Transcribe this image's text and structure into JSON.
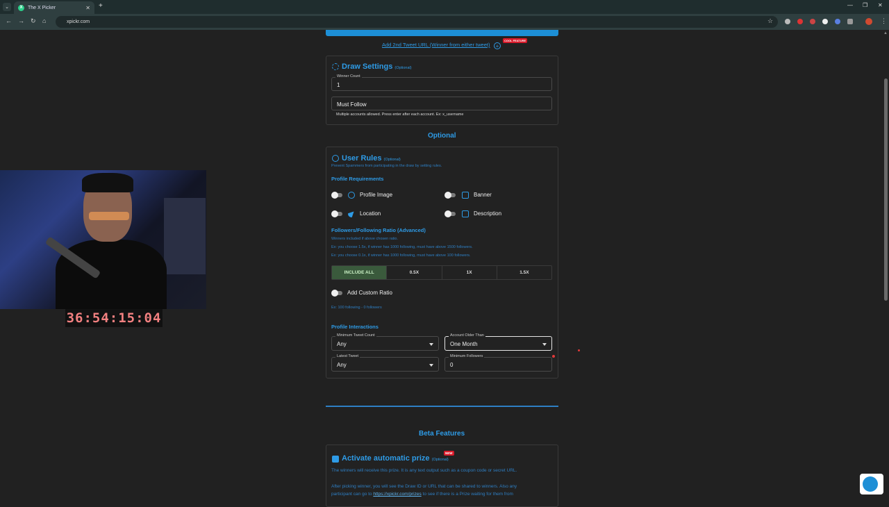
{
  "browser": {
    "tab_title": "The X Picker",
    "url": "xpickr.com"
  },
  "page": {
    "add_second_tweet_link": "Add 2nd Tweet URL (Winner from either tweet)",
    "cool_feature_badge": "COOL FEATURE",
    "draw_settings": {
      "title": "Draw Settings",
      "optional": "(Optional)",
      "winner_count_label": "Winner Count",
      "winner_count_value": "1",
      "must_follow_placeholder": "Must Follow",
      "must_follow_help": "Multiple accounts allowed. Press enter after each account. Ex: x_username"
    },
    "optional_heading": "Optional",
    "user_rules": {
      "title": "User Rules",
      "optional": "(Optional)",
      "subtitle": "Prevent Spammers from participating in the draw by setting rules.",
      "profile_requirements_heading": "Profile Requirements",
      "rules": [
        {
          "label": "Profile Image",
          "icon": "user-circle-icon"
        },
        {
          "label": "Banner",
          "icon": "image-icon"
        },
        {
          "label": "Location",
          "icon": "location-arrow-icon"
        },
        {
          "label": "Description",
          "icon": "edit-icon"
        }
      ],
      "ratio_heading": "Followers/Following Ratio (Advanced)",
      "ratio_note": "Winners included if above chosen ratio.",
      "ratio_example_1": "Ex: you choose 1.5x, if winner has 1000 following, must have above 1500 followers.",
      "ratio_example_2": "Ex: you choose 0.1x, if winner has 1000 following, must have above 100 followers.",
      "ratio_options": [
        "INCLUDE ALL",
        "0.5X",
        "1X",
        "1.5X"
      ],
      "ratio_selected": "INCLUDE ALL",
      "custom_ratio_label": "Add Custom Ratio",
      "custom_ratio_example": "Ex: 100 following - 0 followers",
      "profile_interactions_heading": "Profile Interactions",
      "min_tweet_label": "Minimum Tweet Count",
      "min_tweet_value": "Any",
      "account_older_label": "Account Older Than",
      "account_older_value": "One Month",
      "latest_tweet_label": "Latest Tweet",
      "latest_tweet_value": "Any",
      "min_followers_label": "Minimum Followers",
      "min_followers_value": "0"
    },
    "beta_heading": "Beta Features",
    "prize": {
      "title": "Activate automatic prize",
      "optional": "(Optional)",
      "new_badge": "NEW",
      "line1": "The winners will receive this prize. It is any text output such as a coupon code or secret URL.",
      "line2": "After picking winner, you will see the Draw ID or URL that can be shared to winners. Also any",
      "line3_pre": "participant can go to ",
      "line3_link": "https://xpickr.com/prizes",
      "line3_post": " to see if there is a Prize waiting for them from"
    }
  },
  "overlay": {
    "timer": "36:54:15:04"
  },
  "colors": {
    "accent": "#2e9be6",
    "background": "#212121",
    "selected_ratio": "#3a5a3c"
  }
}
